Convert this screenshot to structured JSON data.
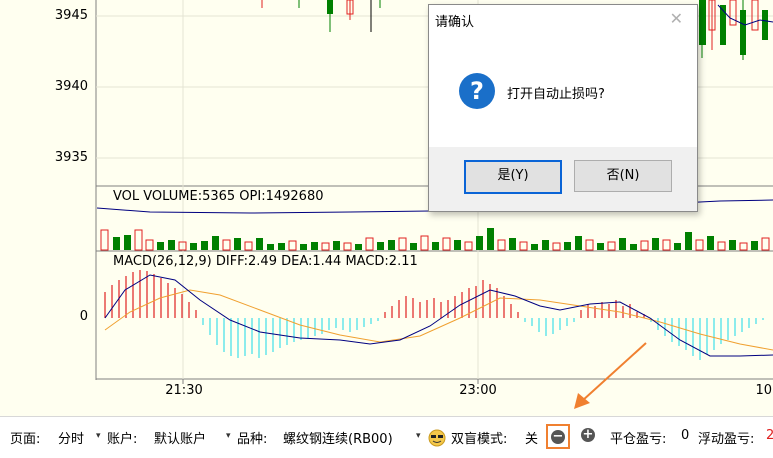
{
  "price_axis": {
    "labels": [
      "3945",
      "3940",
      "3935"
    ]
  },
  "time_axis": {
    "labels": [
      "21:30",
      "23:00",
      "10:"
    ]
  },
  "vol_panel": {
    "label": "VOL  VOLUME:5365 OPI:1492680"
  },
  "macd_panel": {
    "label": "MACD(26,12,9)  DIFF:2.49 DEA:1.44 MACD:2.11",
    "zero_label": "0"
  },
  "dialog": {
    "title": "请确认",
    "close_glyph": "✕",
    "icon_glyph": "?",
    "message": "打开自动止损吗?",
    "yes_label": "是(Y)",
    "no_label": "否(N)"
  },
  "status_bar": {
    "page_label": "页面:",
    "page_value": "分时",
    "account_label": "账户:",
    "account_value": "默认账户",
    "product_label": "品种:",
    "product_value": "螺纹钢连续(RB00)",
    "mode_label": "双盲模式:",
    "mode_value": "关",
    "close_pnl_label": "平仓盈亏:",
    "close_pnl_value": "0",
    "float_pnl_label": "浮动盈亏:",
    "float_pnl_value": "2",
    "caret": "▾",
    "minus_glyph": "−",
    "plus_glyph": "+"
  },
  "colors": {
    "up": "#e02020",
    "down": "#008000",
    "highlight": "#f08030",
    "dialog_blue": "#1a6fc9",
    "macd_neg": "#40e0e8"
  }
}
